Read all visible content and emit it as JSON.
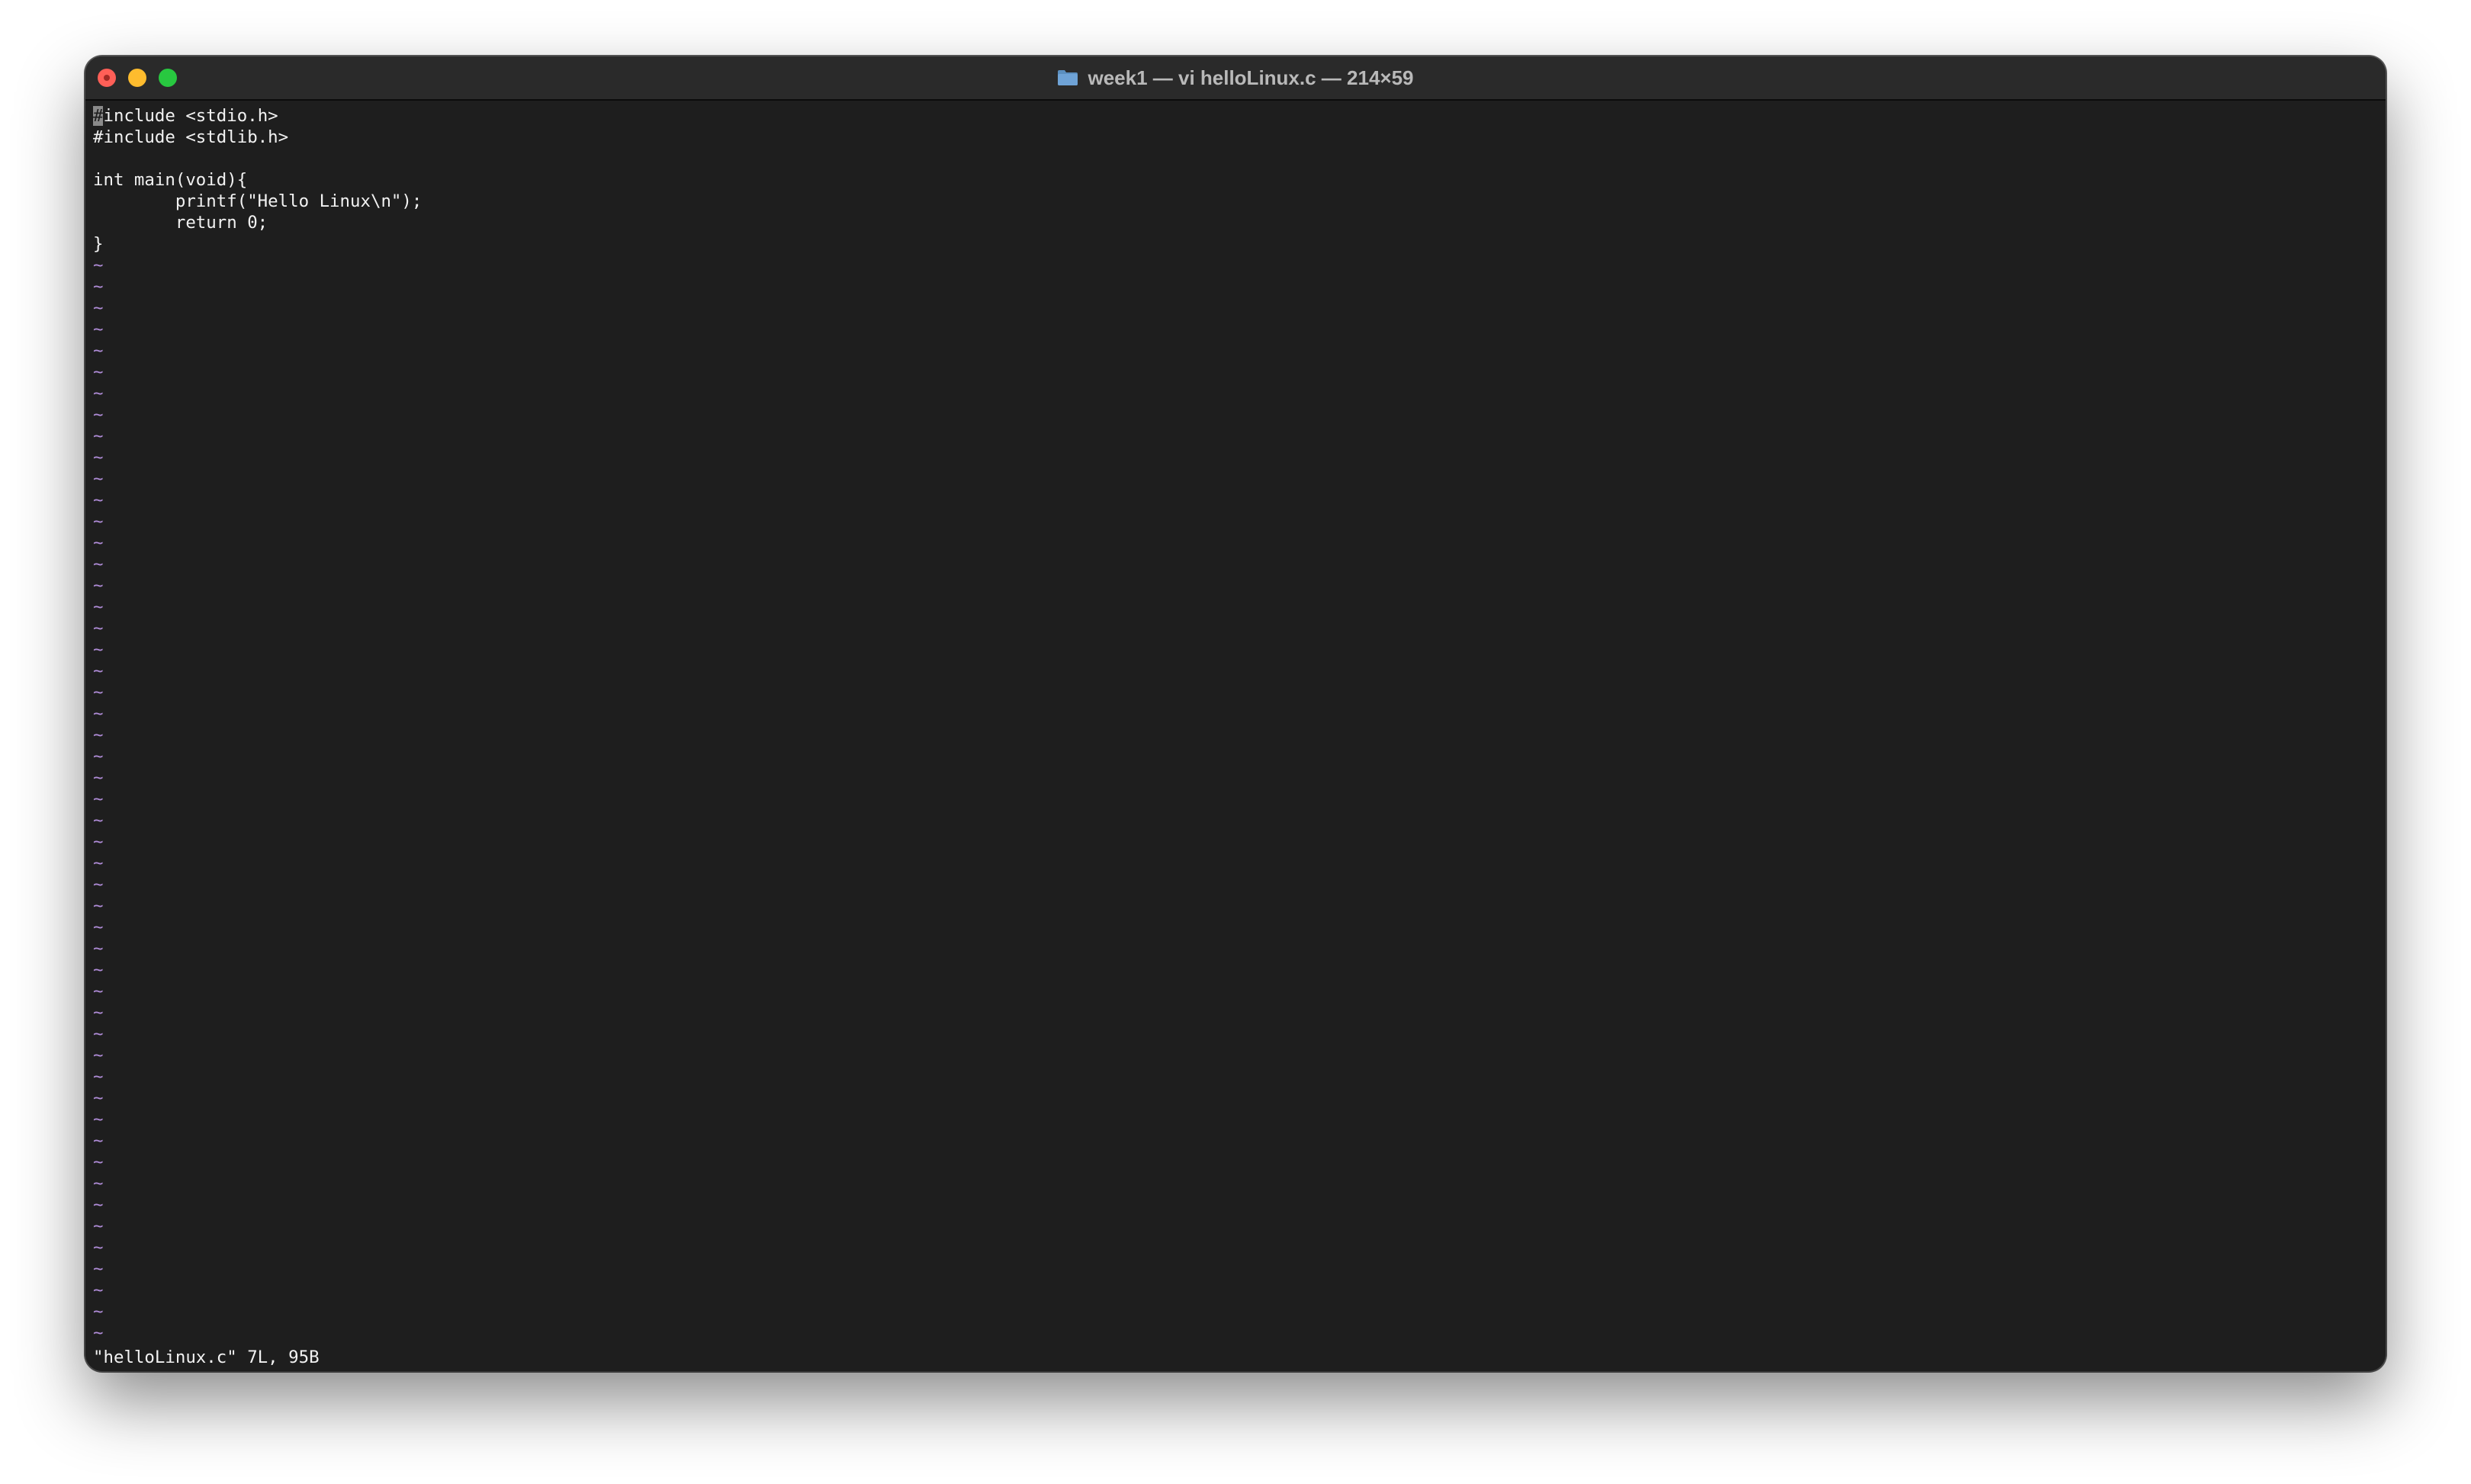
{
  "window": {
    "title": "week1 — vi helloLinux.c — 214×59",
    "title_icon": "folder-icon"
  },
  "editor": {
    "cursor_char": "#",
    "lines": [
      "include <stdio.h>",
      "#include <stdlib.h>",
      "",
      "int main(void){",
      "        printf(\"Hello Linux\\n\");",
      "        return 0;",
      "}"
    ],
    "empty_line_marker": "~",
    "empty_line_count": 51,
    "tilde_color": "#b08cd8"
  },
  "status_line": "\"helloLinux.c\" 7L, 95B",
  "colors": {
    "terminal_bg": "#1e1e1e",
    "titlebar_bg": "#2a2a2a",
    "text": "#f2f2f2",
    "close": "#ff5f57",
    "minimize": "#febc2e",
    "zoom": "#28c840"
  }
}
